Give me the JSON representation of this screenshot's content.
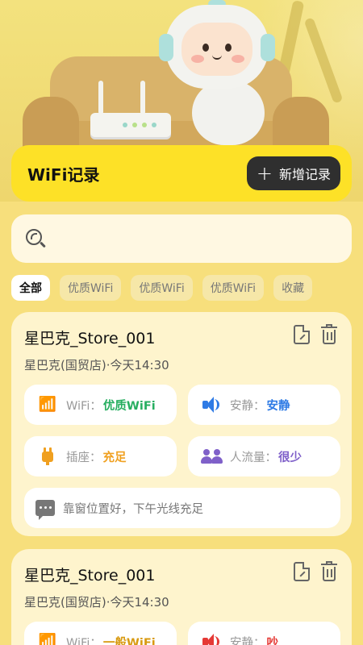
{
  "header": {
    "title": "WiFi记录",
    "add_label": "新增记录"
  },
  "search": {
    "placeholder": ""
  },
  "filters": [
    {
      "label": "全部",
      "active": true
    },
    {
      "label": "优质WiFi",
      "active": false
    },
    {
      "label": "优质WiFi",
      "active": false
    },
    {
      "label": "优质WiFi",
      "active": false
    },
    {
      "label": "收藏",
      "active": false
    }
  ],
  "records": [
    {
      "name": "星巴克_Store_001",
      "meta": "星巴克(国贸店)·今天14:30",
      "tags": [
        {
          "icon": "wifi-icon",
          "label": "WiFi：",
          "value": "优质WiFi",
          "color": "#27ae60"
        },
        {
          "icon": "speaker-icon",
          "label": "安静：",
          "value": "安静",
          "color": "#2f7be5"
        },
        {
          "icon": "plug-icon",
          "label": "插座：",
          "value": "充足",
          "color": "#f0a020"
        },
        {
          "icon": "people-icon",
          "label": "人流量：",
          "value": "很少",
          "color": "#7f60c9"
        }
      ],
      "note": "靠窗位置好，下午光线充足"
    },
    {
      "name": "星巴克_Store_001",
      "meta": "星巴克(国贸店)·今天14:30",
      "tags": [
        {
          "icon": "wifi-icon",
          "label": "WiFi：",
          "value": "一般WiFi",
          "color": "#d89a10"
        },
        {
          "icon": "speaker-icon",
          "label": "安静：",
          "value": "吵",
          "color": "#e53935"
        }
      ]
    }
  ],
  "colors": {
    "accent": "#fde127",
    "background": "#f7df7c",
    "card": "#fef4cd",
    "button_dark": "#2f2f2f"
  }
}
